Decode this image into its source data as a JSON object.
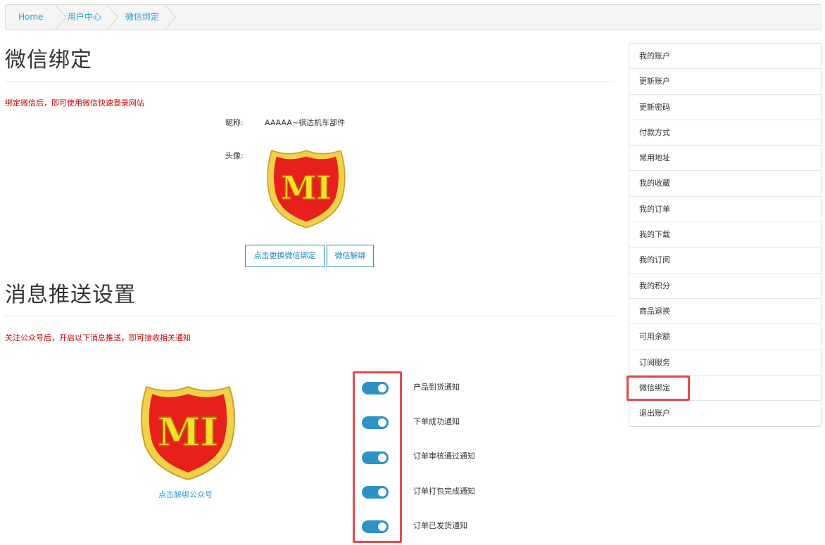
{
  "breadcrumb": {
    "items": [
      "Home",
      "用户中心",
      "微信绑定"
    ]
  },
  "binding": {
    "title": "微信绑定",
    "note": "绑定微信后，即可使用微信快速登录网站",
    "nickname_label": "昵称:",
    "nickname_value": "AAAAA~祺达机车部件",
    "avatar_label": "头像:",
    "change_button": "点击更换微信绑定",
    "unbind_button": "微信解绑"
  },
  "push": {
    "title": "消息推送设置",
    "note": "关注公众号后，开启以下消息推送，即可接收相关通知",
    "unbind_link": "点击解绑公众号",
    "toggles": [
      {
        "label": "产品到货通知",
        "on": true
      },
      {
        "label": "下单成功通知",
        "on": true
      },
      {
        "label": "订单审核通过通知",
        "on": true
      },
      {
        "label": "订单打包完成通知",
        "on": true
      },
      {
        "label": "订单已发货通知",
        "on": true
      }
    ]
  },
  "logo": {
    "text": "MI",
    "shield_color": "#e8201c",
    "border_color": "#f2d14a",
    "letter_color": "#f5e12a"
  },
  "sidebar": {
    "items": [
      "我的账户",
      "更新账户",
      "更新密码",
      "付款方式",
      "常用地址",
      "我的收藏",
      "我的订单",
      "我的下载",
      "我的订阅",
      "我的积分",
      "商品退换",
      "可用余额",
      "订阅服务",
      "微信绑定",
      "退出账户"
    ],
    "active_index": 13
  },
  "colors": {
    "accent": "#2a9fd0",
    "toggle_on": "#2d92c4",
    "highlight": "#e04b4b",
    "note": "#d20000"
  }
}
